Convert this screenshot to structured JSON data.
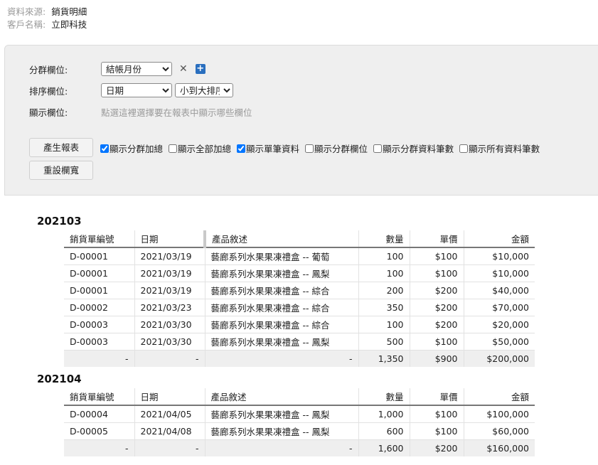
{
  "meta": {
    "source_label": "資料來源:",
    "source_value": "銷貨明細",
    "customer_label": "客戶名稱:",
    "customer_value": "立即科技"
  },
  "form": {
    "group_label": "分群欄位:",
    "group_selected": "結帳月份",
    "sort_label": "排序欄位:",
    "sort_field_selected": "日期",
    "sort_order_selected": "小到大排序",
    "display_label": "顯示欄位:",
    "display_hint": "點選這裡選擇要在報表中顯示哪些欄位",
    "generate_button": "產生報表",
    "reset_button": "重設欄寬",
    "options": [
      {
        "label": "顯示分群加總",
        "checked": true
      },
      {
        "label": "顯示全部加總",
        "checked": false
      },
      {
        "label": "顯示單筆資料",
        "checked": true
      },
      {
        "label": "顯示分群欄位",
        "checked": false
      },
      {
        "label": "顯示分群資料筆數",
        "checked": false
      },
      {
        "label": "顯示所有資料筆數",
        "checked": false
      }
    ]
  },
  "columns": [
    "銷貨單編號",
    "日期",
    "產品敘述",
    "數量",
    "單價",
    "金額"
  ],
  "groups": [
    {
      "title": "202103",
      "rows": [
        [
          "D-00001",
          "2021/03/19",
          "藝廊系列水果果凍禮盒 -- 葡萄",
          "100",
          "$100",
          "$10,000"
        ],
        [
          "D-00001",
          "2021/03/19",
          "藝廊系列水果果凍禮盒 -- 鳳梨",
          "100",
          "$100",
          "$10,000"
        ],
        [
          "D-00001",
          "2021/03/19",
          "藝廊系列水果果凍禮盒 -- 綜合",
          "200",
          "$200",
          "$40,000"
        ],
        [
          "D-00002",
          "2021/03/23",
          "藝廊系列水果果凍禮盒 -- 綜合",
          "350",
          "$200",
          "$70,000"
        ],
        [
          "D-00003",
          "2021/03/30",
          "藝廊系列水果果凍禮盒 -- 綜合",
          "100",
          "$200",
          "$20,000"
        ],
        [
          "D-00003",
          "2021/03/30",
          "藝廊系列水果果凍禮盒 -- 鳳梨",
          "500",
          "$100",
          "$50,000"
        ]
      ],
      "summary": [
        "-",
        "-",
        "-",
        "1,350",
        "$900",
        "$200,000"
      ]
    },
    {
      "title": "202104",
      "rows": [
        [
          "D-00004",
          "2021/04/05",
          "藝廊系列水果果凍禮盒 -- 鳳梨",
          "1,000",
          "$100",
          "$100,000"
        ],
        [
          "D-00005",
          "2021/04/08",
          "藝廊系列水果果凍禮盒 -- 鳳梨",
          "600",
          "$100",
          "$60,000"
        ]
      ],
      "summary": [
        "-",
        "-",
        "-",
        "1,600",
        "$200",
        "$160,000"
      ]
    }
  ]
}
